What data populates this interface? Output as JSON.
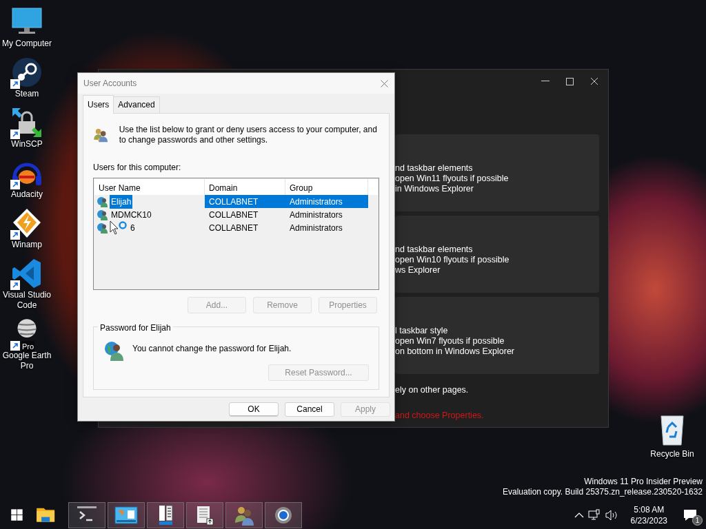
{
  "desktop_icons": [
    {
      "kind": "computer",
      "label": "My Computer",
      "shortcut": false
    },
    {
      "kind": "steam",
      "label": "Steam",
      "shortcut": true
    },
    {
      "kind": "winscp",
      "label": "WinSCP",
      "shortcut": true
    },
    {
      "kind": "audacity",
      "label": "Audacity",
      "shortcut": true
    },
    {
      "kind": "winamp",
      "label": "Winamp",
      "shortcut": true
    },
    {
      "kind": "vscode",
      "label": "Visual Studio Code",
      "shortcut": true
    },
    {
      "kind": "earth",
      "label": "Google Earth Pro",
      "shortcut": true,
      "badge": "Pro"
    }
  ],
  "recycle_bin": {
    "label": "Recycle Bin"
  },
  "background_window": {
    "cards": [
      {
        "lines": [
          "nd taskbar elements",
          "open Win11 flyouts if possible",
          "in Windows Explorer"
        ]
      },
      {
        "lines": [
          "nd taskbar elements",
          "open Win10 flyouts if possible",
          "ws Explorer"
        ]
      },
      {
        "lines": [
          "l taskbar style",
          "open Win7 flyouts if possible",
          "on bottom in Windows Explorer"
        ]
      }
    ],
    "note": "ely on other pages.",
    "warning": "and choose Properties."
  },
  "dialog": {
    "title": "User Accounts",
    "tabs": [
      {
        "label": "Users",
        "selected": true
      },
      {
        "label": "Advanced",
        "selected": false
      }
    ],
    "intro": "Use the list below to grant or deny users access to your computer, and to change passwords and other settings.",
    "list_label": "Users for this computer:",
    "columns": [
      "User Name",
      "Domain",
      "Group"
    ],
    "rows": [
      {
        "name": "Elijah",
        "domain": "COLLABNET",
        "group": "Administrators",
        "selected": true,
        "cursor": false
      },
      {
        "name": "MDMCK10",
        "domain": "COLLABNET",
        "group": "Administrators",
        "selected": false,
        "cursor": false
      },
      {
        "name": "6",
        "domain": "COLLABNET",
        "group": "Administrators",
        "selected": false,
        "cursor": true
      }
    ],
    "list_buttons": [
      {
        "label": "Add...",
        "disabled": true
      },
      {
        "label": "Remove",
        "disabled": true
      },
      {
        "label": "Properties",
        "disabled": true
      }
    ],
    "password_group": {
      "title": "Password for Elijah",
      "message": "You cannot change the password for Elijah.",
      "button": {
        "label": "Reset Password...",
        "disabled": true
      }
    },
    "footer_buttons": [
      {
        "label": "OK",
        "disabled": false,
        "default": true
      },
      {
        "label": "Cancel",
        "disabled": false,
        "default": false
      },
      {
        "label": "Apply",
        "disabled": true,
        "default": false
      }
    ]
  },
  "edition_notice": [
    "Windows 11 Pro Insider Preview",
    "Evaluation copy. Build 25375.zn_release.230520-1632"
  ],
  "taskbar": {
    "items": [
      {
        "kind": "start",
        "running": false
      },
      {
        "kind": "folder",
        "running": false
      },
      {
        "kind": "terminal",
        "running": true
      },
      {
        "kind": "diagram",
        "running": true
      },
      {
        "kind": "panel",
        "running": true
      },
      {
        "kind": "document",
        "running": true
      },
      {
        "kind": "users",
        "running": true
      },
      {
        "kind": "gear",
        "running": true
      }
    ],
    "clock": {
      "time": "5:08 AM",
      "date": "6/23/2023"
    },
    "notification_count": "1"
  }
}
